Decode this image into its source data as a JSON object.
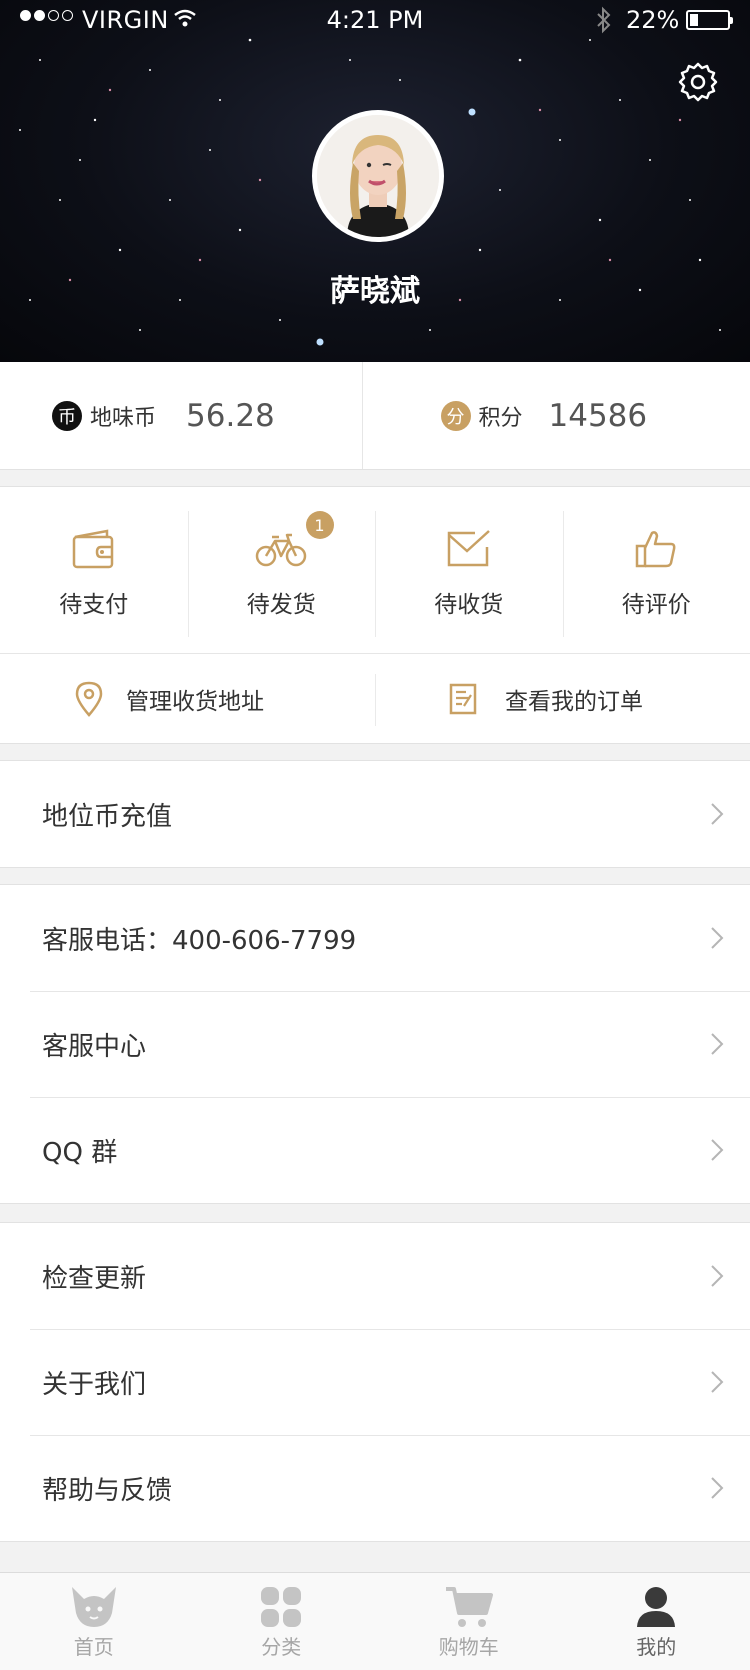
{
  "status_bar": {
    "carrier": "VIRGIN",
    "time": "4:21 PM",
    "battery": "22%"
  },
  "profile": {
    "username": "萨晓斌",
    "settings_icon": "gear-icon"
  },
  "balance": {
    "coin": {
      "icon_text": "币",
      "label": "地味币",
      "value": "56.28"
    },
    "points": {
      "icon_text": "分",
      "label": "积分",
      "value": "14586"
    }
  },
  "orders": [
    {
      "label": "待支付",
      "icon": "wallet-icon"
    },
    {
      "label": "待发货",
      "icon": "bicycle-icon",
      "badge": "1"
    },
    {
      "label": "待收货",
      "icon": "envelope-check-icon"
    },
    {
      "label": "待评价",
      "icon": "thumbs-up-icon"
    }
  ],
  "quick_links": [
    {
      "label": "管理收货地址",
      "icon": "location-pin-icon"
    },
    {
      "label": "查看我的订单",
      "icon": "order-list-icon"
    }
  ],
  "menu": {
    "recharge": "地位币充值",
    "service_phone": "客服电话：400-606-7799",
    "service_center": "客服中心",
    "qq_group": "QQ 群",
    "check_update": "检查更新",
    "about": "关于我们",
    "help": "帮助与反馈"
  },
  "tabbar": [
    {
      "label": "首页",
      "icon": "home-mascot-icon",
      "active": false
    },
    {
      "label": "分类",
      "icon": "category-grid-icon",
      "active": false
    },
    {
      "label": "购物车",
      "icon": "cart-icon",
      "active": false
    },
    {
      "label": "我的",
      "icon": "user-icon",
      "active": true
    }
  ],
  "colors": {
    "accent_gold": "#c8a063",
    "text_dark": "#333333",
    "background": "#f2f2f2"
  }
}
